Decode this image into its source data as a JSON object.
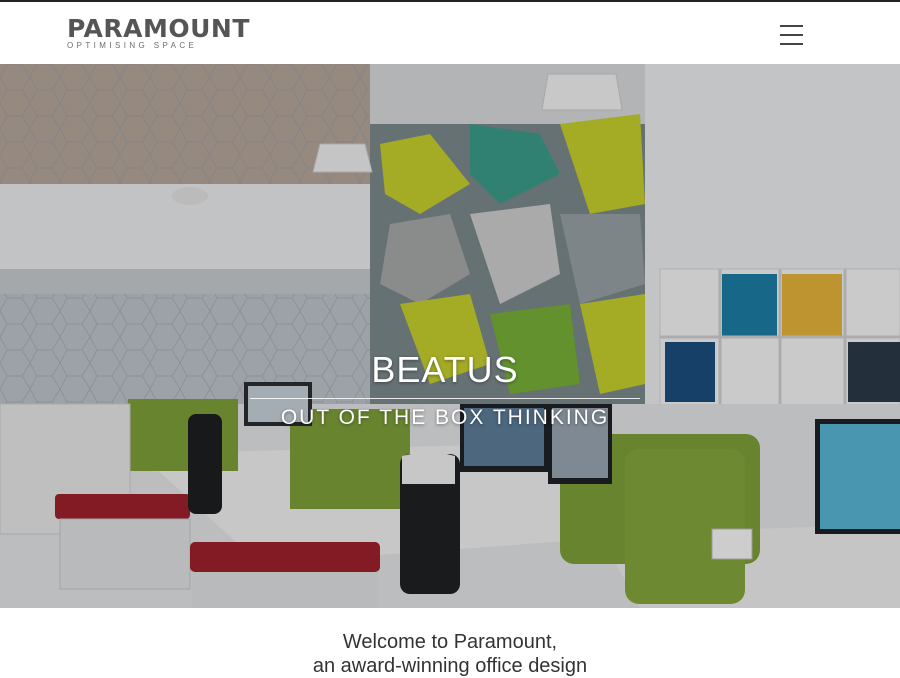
{
  "brand": {
    "name": "PARAMOUNT",
    "tagline": "OPTIMISING SPACE"
  },
  "header": {
    "menu_icon": "hamburger-menu-icon"
  },
  "hero": {
    "title": "BEATUS",
    "subtitle": "OUT OF THE BOX THINKING"
  },
  "welcome": {
    "line1": "Welcome to Paramount,",
    "line2": "an award-winning office design"
  },
  "colors": {
    "accent_green": "#7fa23a",
    "accent_red": "#a0222c",
    "logo_gray": "#555555"
  }
}
